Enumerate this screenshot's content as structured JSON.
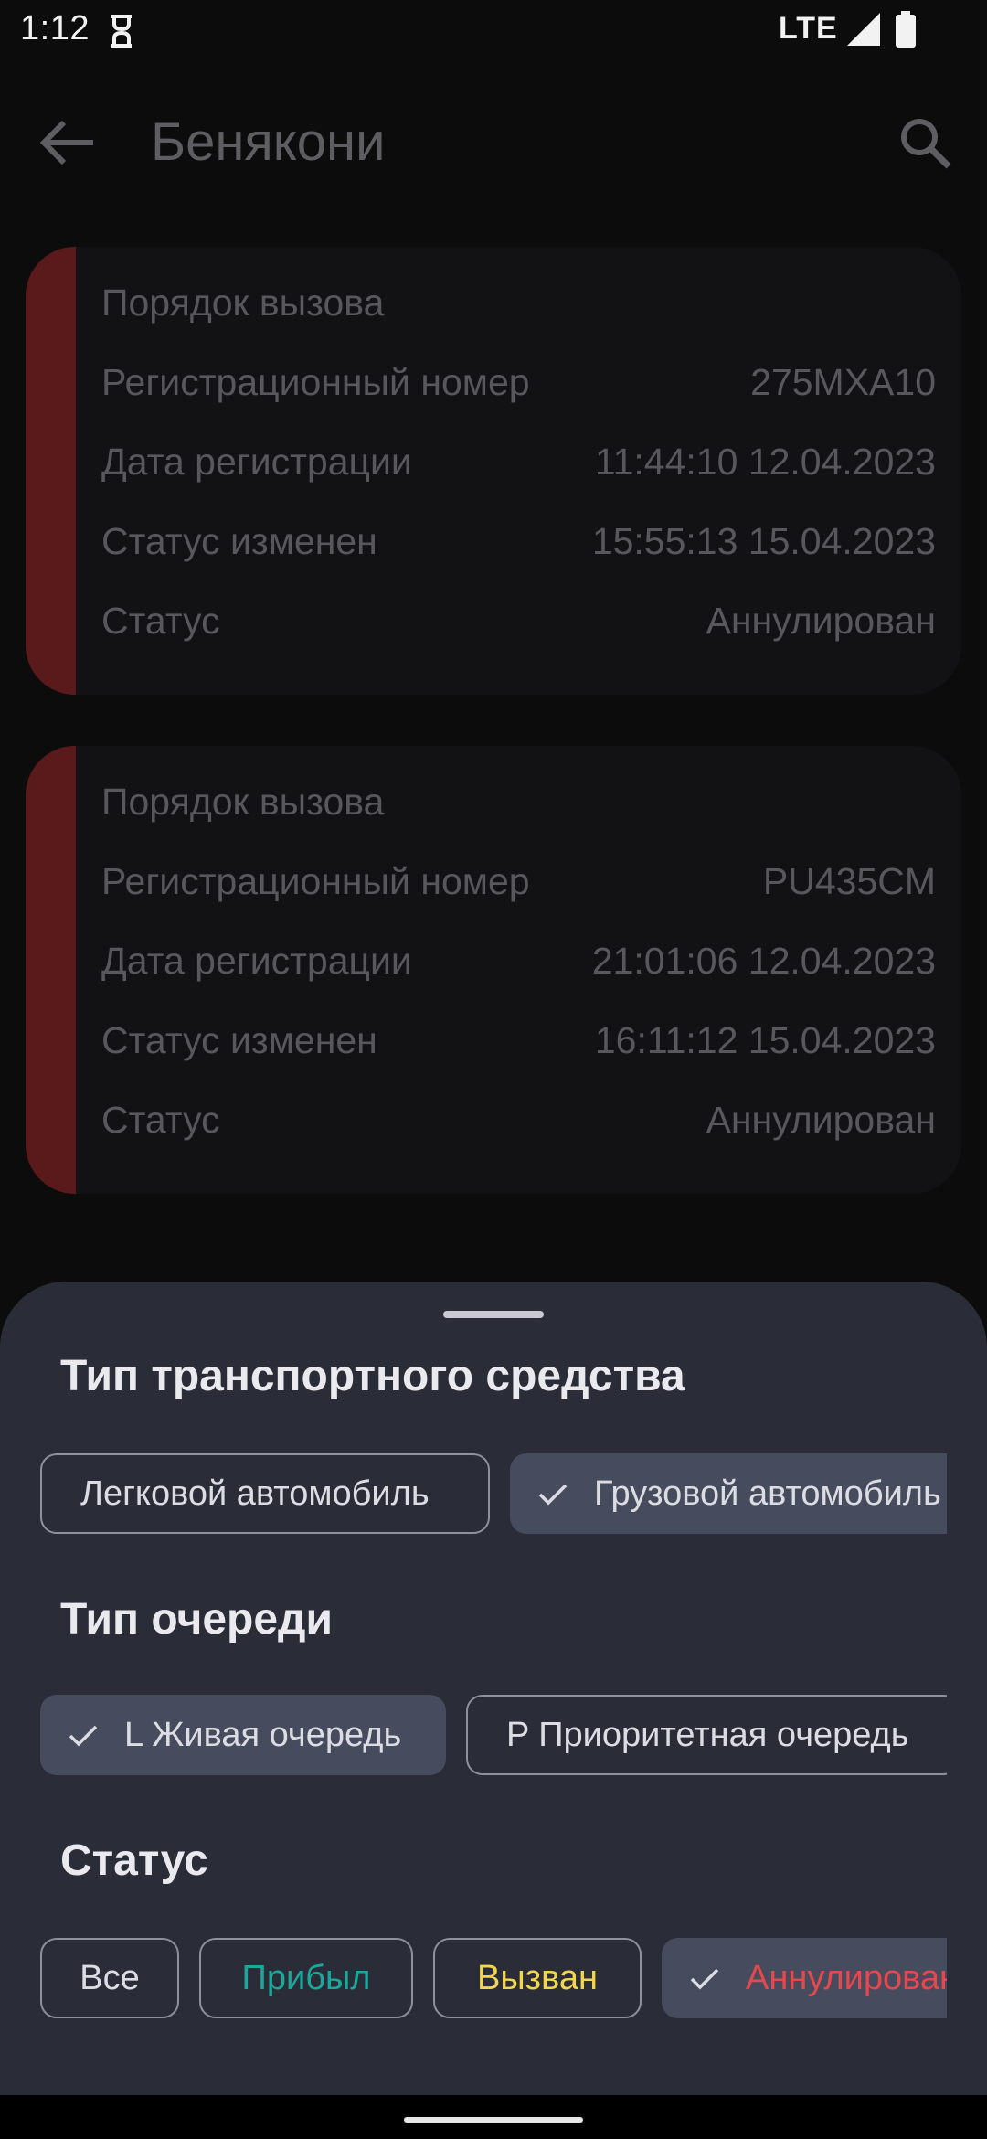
{
  "status_bar": {
    "time": "1:12",
    "network": "LTE"
  },
  "app_bar": {
    "title": "Бенякони"
  },
  "cards": [
    {
      "title": "Порядок вызова",
      "rows": [
        {
          "label": "Регистрационный номер",
          "value": "275MXA10"
        },
        {
          "label": "Дата регистрации",
          "value": "11:44:10 12.04.2023"
        },
        {
          "label": "Статус изменен",
          "value": "15:55:13 15.04.2023"
        },
        {
          "label": "Статус",
          "value": "Аннулирован"
        }
      ]
    },
    {
      "title": "Порядок вызова",
      "rows": [
        {
          "label": "Регистрационный номер",
          "value": "PU435CM"
        },
        {
          "label": "Дата регистрации",
          "value": "21:01:06 12.04.2023"
        },
        {
          "label": "Статус изменен",
          "value": "16:11:12 15.04.2023"
        },
        {
          "label": "Статус",
          "value": "Аннулирован"
        }
      ]
    }
  ],
  "sheet": {
    "vehicle_type": {
      "title": "Тип транспортного средства",
      "chips": [
        {
          "label": "Легковой автомобиль",
          "selected": false
        },
        {
          "label": "Грузовой автомобиль",
          "selected": true
        }
      ]
    },
    "queue_type": {
      "title": "Тип очереди",
      "chips": [
        {
          "label": "L Живая очередь",
          "selected": true
        },
        {
          "label": "P Приоритетная очередь",
          "selected": false
        }
      ]
    },
    "status": {
      "title": "Статус",
      "chips": [
        {
          "label": "Все",
          "selected": false,
          "color": "#dcdde3"
        },
        {
          "label": "Прибыл",
          "selected": false,
          "color": "#1aa89a"
        },
        {
          "label": "Вызван",
          "selected": false,
          "color": "#f2d64b"
        },
        {
          "label": "Аннулирован",
          "selected": true,
          "color": "#e5484d"
        }
      ]
    }
  },
  "colors": {
    "card_stripe": "#5a1a1c",
    "sheet_bg": "#2a2c38",
    "chip_selected_bg": "#474b5e"
  }
}
